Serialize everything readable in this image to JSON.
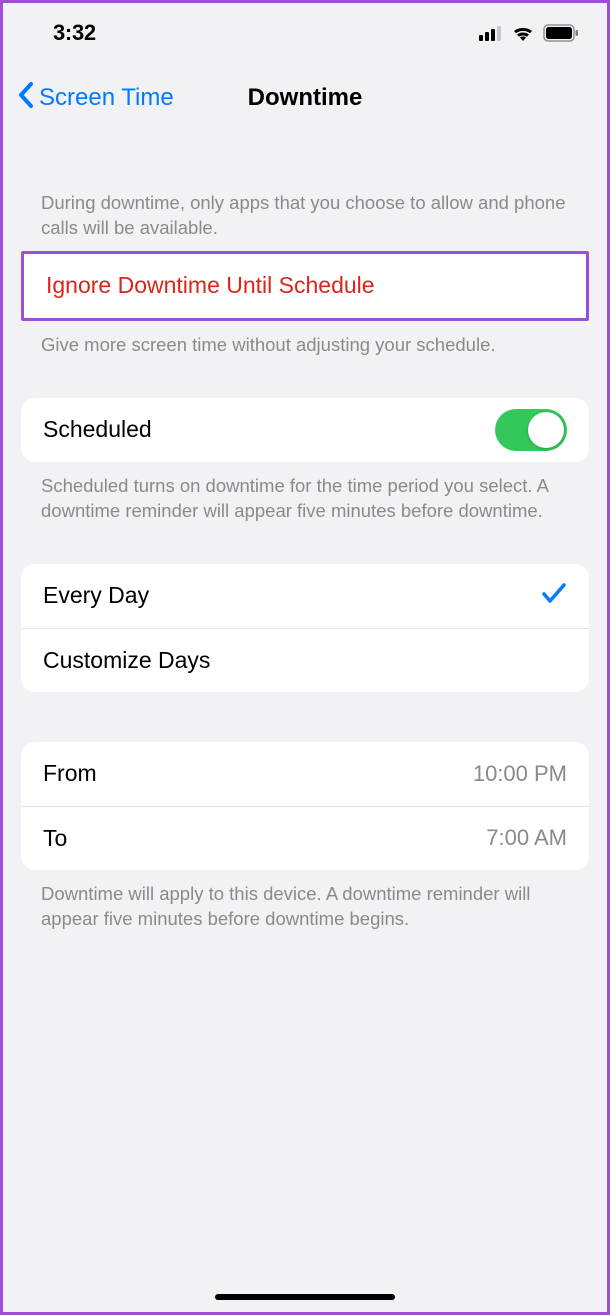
{
  "status": {
    "time": "3:32"
  },
  "nav": {
    "back_label": "Screen Time",
    "title": "Downtime"
  },
  "intro_desc": "During downtime, only apps that you choose to allow and phone calls will be available.",
  "ignore": {
    "label": "Ignore Downtime Until Schedule",
    "desc": "Give more screen time without adjusting your schedule."
  },
  "scheduled": {
    "label": "Scheduled",
    "enabled": true,
    "desc": "Scheduled turns on downtime for the time period you select. A downtime reminder will appear five minutes before downtime."
  },
  "schedule_type": {
    "every_day": "Every Day",
    "customize": "Customize Days",
    "selected": "every_day"
  },
  "times": {
    "from_label": "From",
    "from_value": "10:00 PM",
    "to_label": "To",
    "to_value": "7:00 AM",
    "desc": "Downtime will apply to this device. A downtime reminder will appear five minutes before downtime begins."
  }
}
